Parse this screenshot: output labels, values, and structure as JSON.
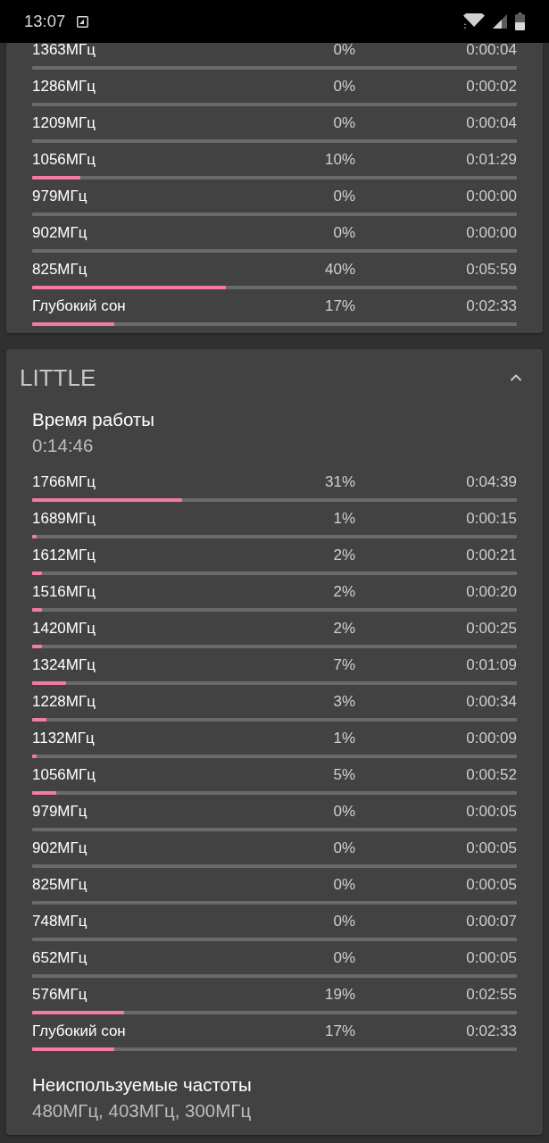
{
  "status_bar": {
    "time": "13:07"
  },
  "cards": [
    {
      "rows": [
        {
          "label": "1363МГц",
          "percent": "0%",
          "time": "0:00:04"
        },
        {
          "label": "1286МГц",
          "percent": "0%",
          "time": "0:00:02"
        },
        {
          "label": "1209МГц",
          "percent": "0%",
          "time": "0:00:04"
        },
        {
          "label": "1056МГц",
          "percent": "10%",
          "time": "0:01:29",
          "level": 0.1
        },
        {
          "label": "979МГц",
          "percent": "0%",
          "time": "0:00:00"
        },
        {
          "label": "902МГц",
          "percent": "0%",
          "time": "0:00:00"
        },
        {
          "label": "825МГц",
          "percent": "40%",
          "time": "0:05:59",
          "level": 0.4
        },
        {
          "label": "Глубокий сон",
          "percent": "17%",
          "time": "0:02:33",
          "level": 0.17
        }
      ]
    },
    {
      "title": "LITTLE",
      "expanded": true,
      "uptime": {
        "label": "Время работы",
        "value": "0:14:46"
      },
      "rows": [
        {
          "label": "1766МГц",
          "percent": "31%",
          "time": "0:04:39",
          "level": 0.31
        },
        {
          "label": "1689МГц",
          "percent": "1%",
          "time": "0:00:15",
          "level": 0.01
        },
        {
          "label": "1612МГц",
          "percent": "2%",
          "time": "0:00:21",
          "level": 0.02
        },
        {
          "label": "1516МГц",
          "percent": "2%",
          "time": "0:00:20",
          "level": 0.02
        },
        {
          "label": "1420МГц",
          "percent": "2%",
          "time": "0:00:25",
          "level": 0.02
        },
        {
          "label": "1324МГц",
          "percent": "7%",
          "time": "0:01:09",
          "level": 0.07
        },
        {
          "label": "1228МГц",
          "percent": "3%",
          "time": "0:00:34",
          "level": 0.03
        },
        {
          "label": "1132МГц",
          "percent": "1%",
          "time": "0:00:09",
          "level": 0.01
        },
        {
          "label": "1056МГц",
          "percent": "5%",
          "time": "0:00:52",
          "level": 0.05
        },
        {
          "label": "979МГц",
          "percent": "0%",
          "time": "0:00:05"
        },
        {
          "label": "902МГц",
          "percent": "0%",
          "time": "0:00:05"
        },
        {
          "label": "825МГц",
          "percent": "0%",
          "time": "0:00:05"
        },
        {
          "label": "748МГц",
          "percent": "0%",
          "time": "0:00:07"
        },
        {
          "label": "652МГц",
          "percent": "0%",
          "time": "0:00:05"
        },
        {
          "label": "576МГц",
          "percent": "19%",
          "time": "0:02:55",
          "level": 0.19
        },
        {
          "label": "Глубокий сон",
          "percent": "17%",
          "time": "0:02:33",
          "level": 0.17
        }
      ],
      "unused": {
        "label": "Неиспользуемые частоты",
        "value": "480МГц, 403МГц, 300МГц"
      }
    }
  ]
}
